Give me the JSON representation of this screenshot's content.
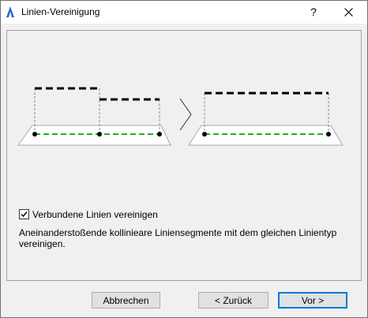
{
  "window": {
    "title": "Linien-Vereinigung",
    "help_glyph": "?"
  },
  "icons": {
    "app": "archicad-app-icon",
    "help": "question-mark-icon",
    "close": "close-icon",
    "arrow": "chevron-right-icon"
  },
  "options": {
    "merge_checkbox": {
      "label": "Verbundene Linien vereinigen",
      "checked": true
    },
    "description": "Aneinanderstoßende kollinieare Liniensegmente mit dem gleichen Linientyp vereinigen."
  },
  "buttons": {
    "cancel": "Abbrechen",
    "back": "< Zurück",
    "next": "Vor >"
  },
  "colors": {
    "accent": "#0078d7",
    "guide_line": "#1fb21f"
  }
}
